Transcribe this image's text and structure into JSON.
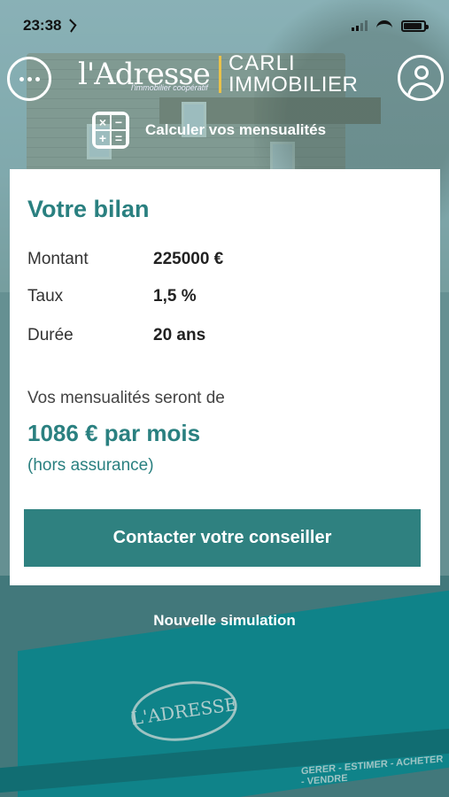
{
  "status_bar": {
    "time": "23:38"
  },
  "header": {
    "brand_left": "l'Adresse",
    "brand_tagline": "l'immobilier coopératif",
    "brand_right_top": "CARLI",
    "brand_right_bottom": "IMMOBILIER",
    "calc_label": "Calculer vos mensualités"
  },
  "card": {
    "title": "Votre bilan",
    "rows": [
      {
        "label": "Montant",
        "value": "225000 €"
      },
      {
        "label": "Taux",
        "value": "1,5 %"
      },
      {
        "label": "Durée",
        "value": "20 ans"
      }
    ],
    "intro": "Vos mensualités seront de",
    "result": "1086 € par mois",
    "note": "(hors assurance)",
    "cta_label": "Contacter votre conseiller"
  },
  "footer": {
    "new_simulation": "Nouvelle simulation"
  },
  "background": {
    "shop_sign": "L'ADRESSE",
    "strip_text": "GERER - ESTIMER - ACHETER - VENDRE"
  },
  "colors": {
    "accent": "#2f8180",
    "teal_text": "#2a8080"
  }
}
